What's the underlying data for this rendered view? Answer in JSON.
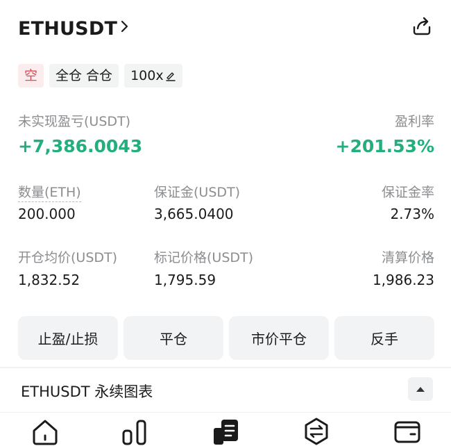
{
  "header": {
    "symbol": "ETHUSDT"
  },
  "tags": {
    "side": "空",
    "mode": "全仓 合仓",
    "leverage": "100x"
  },
  "pnl": {
    "unrealized_label": "未实现盈亏(USDT)",
    "unrealized_value": "+7,386.0043",
    "roe_label": "盈利率",
    "roe_value": "+201.53%"
  },
  "stats": {
    "size_label": "数量(ETH)",
    "size_value": "200.000",
    "margin_label": "保证金(USDT)",
    "margin_value": "3,665.0400",
    "margin_ratio_label": "保证金率",
    "margin_ratio_value": "2.73%",
    "entry_label": "开仓均价(USDT)",
    "entry_value": "1,832.52",
    "mark_label": "标记价格(USDT)",
    "mark_value": "1,795.59",
    "liq_label": "清算价格",
    "liq_value": "1,986.23"
  },
  "actions": {
    "tpsl": "止盈/止损",
    "close": "平仓",
    "market_close": "市价平仓",
    "reverse": "反手"
  },
  "chart": {
    "title": "ETHUSDT 永续图表"
  },
  "colors": {
    "profit": "#24ae7c",
    "short": "#e04a59",
    "muted": "#8b8d90"
  },
  "icons": [
    "chevron-right-icon",
    "share-icon",
    "edit-icon",
    "caret-up-icon",
    "home-icon",
    "markets-icon",
    "trade-icon",
    "swap-icon",
    "wallet-icon"
  ]
}
